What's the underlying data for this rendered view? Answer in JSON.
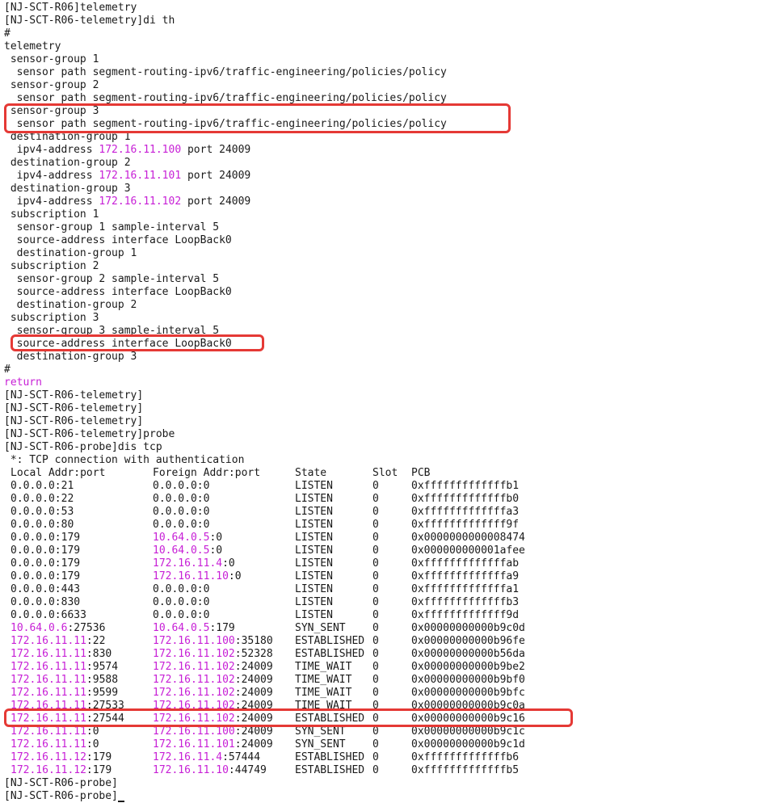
{
  "config_lines": [
    "[NJ-SCT-R06]telemetry",
    "[NJ-SCT-R06-telemetry]di th",
    "#",
    "telemetry",
    " sensor-group 1",
    "  sensor path segment-routing-ipv6/traffic-engineering/policies/policy",
    " sensor-group 2",
    "  sensor path segment-routing-ipv6/traffic-engineering/policies/policy",
    " sensor-group 3",
    "  sensor path segment-routing-ipv6/traffic-engineering/policies/policy",
    " destination-group 1",
    [
      "  ipv4-address ",
      "172.16.11.100",
      " port 24009"
    ],
    " destination-group 2",
    [
      "  ipv4-address ",
      "172.16.11.101",
      " port 24009"
    ],
    " destination-group 3",
    [
      "  ipv4-address ",
      "172.16.11.102",
      " port 24009"
    ],
    " subscription 1",
    "  sensor-group 1 sample-interval 5",
    "  source-address interface LoopBack0",
    "  destination-group 1",
    " subscription 2",
    "  sensor-group 2 sample-interval 5",
    "  source-address interface LoopBack0",
    "  destination-group 2",
    " subscription 3",
    "  sensor-group 3 sample-interval 5",
    "  source-address interface LoopBack0",
    "  destination-group 3",
    "#"
  ],
  "return_word": "return",
  "post_lines": [
    "[NJ-SCT-R06-telemetry]",
    "[NJ-SCT-R06-telemetry]",
    "[NJ-SCT-R06-telemetry]",
    "[NJ-SCT-R06-telemetry]probe",
    "[NJ-SCT-R06-probe]dis tcp",
    " *: TCP connection with authentication"
  ],
  "tcp_header": [
    "Local Addr:port",
    "Foreign Addr:port",
    "State",
    "Slot",
    "PCB"
  ],
  "tcp_rows": [
    [
      [
        "",
        "0.0.0.0",
        ":21"
      ],
      [
        "",
        "0.0.0.0",
        ":0"
      ],
      "LISTEN",
      "0",
      "0xfffffffffffffb1"
    ],
    [
      [
        "",
        "0.0.0.0",
        ":22"
      ],
      [
        "",
        "0.0.0.0",
        ":0"
      ],
      "LISTEN",
      "0",
      "0xfffffffffffffb0"
    ],
    [
      [
        "",
        "0.0.0.0",
        ":53"
      ],
      [
        "",
        "0.0.0.0",
        ":0"
      ],
      "LISTEN",
      "0",
      "0xfffffffffffffa3"
    ],
    [
      [
        "",
        "0.0.0.0",
        ":80"
      ],
      [
        "",
        "0.0.0.0",
        ":0"
      ],
      "LISTEN",
      "0",
      "0xfffffffffffff9f"
    ],
    [
      [
        "",
        "0.0.0.0",
        ":179"
      ],
      [
        "ip",
        "10.64.0.5",
        ":0"
      ],
      "LISTEN",
      "0",
      "0x0000000000008474"
    ],
    [
      [
        "",
        "0.0.0.0",
        ":179"
      ],
      [
        "ip",
        "10.64.0.5",
        ":0"
      ],
      "LISTEN",
      "0",
      "0x000000000001afee"
    ],
    [
      [
        "",
        "0.0.0.0",
        ":179"
      ],
      [
        "ip",
        "172.16.11.4",
        ":0"
      ],
      "LISTEN",
      "0",
      "0xfffffffffffffab"
    ],
    [
      [
        "",
        "0.0.0.0",
        ":179"
      ],
      [
        "ip",
        "172.16.11.10",
        ":0"
      ],
      "LISTEN",
      "0",
      "0xfffffffffffffa9"
    ],
    [
      [
        "",
        "0.0.0.0",
        ":443"
      ],
      [
        "",
        "0.0.0.0",
        ":0"
      ],
      "LISTEN",
      "0",
      "0xfffffffffffffa1"
    ],
    [
      [
        "",
        "0.0.0.0",
        ":830"
      ],
      [
        "",
        "0.0.0.0",
        ":0"
      ],
      "LISTEN",
      "0",
      "0xfffffffffffffb3"
    ],
    [
      [
        "",
        "0.0.0.0",
        ":6633"
      ],
      [
        "",
        "0.0.0.0",
        ":0"
      ],
      "LISTEN",
      "0",
      "0xfffffffffffff9d"
    ],
    [
      [
        "ip",
        "10.64.0.6",
        ":27536"
      ],
      [
        "ip",
        "10.64.0.5",
        ":179"
      ],
      "SYN_SENT",
      "0",
      "0x00000000000b9c0d"
    ],
    [
      [
        "ip",
        "172.16.11.11",
        ":22"
      ],
      [
        "ip",
        "172.16.11.100",
        ":35180"
      ],
      "ESTABLISHED",
      "0",
      "0x00000000000b96fe"
    ],
    [
      [
        "ip",
        "172.16.11.11",
        ":830"
      ],
      [
        "ip",
        "172.16.11.102",
        ":52328"
      ],
      "ESTABLISHED",
      "0",
      "0x00000000000b56da"
    ],
    [
      [
        "ip",
        "172.16.11.11",
        ":9574"
      ],
      [
        "ip",
        "172.16.11.102",
        ":24009"
      ],
      "TIME_WAIT",
      "0",
      "0x00000000000b9be2"
    ],
    [
      [
        "ip",
        "172.16.11.11",
        ":9588"
      ],
      [
        "ip",
        "172.16.11.102",
        ":24009"
      ],
      "TIME_WAIT",
      "0",
      "0x00000000000b9bf0"
    ],
    [
      [
        "ip",
        "172.16.11.11",
        ":9599"
      ],
      [
        "ip",
        "172.16.11.102",
        ":24009"
      ],
      "TIME_WAIT",
      "0",
      "0x00000000000b9bfc"
    ],
    [
      [
        "ip",
        "172.16.11.11",
        ":27533"
      ],
      [
        "ip",
        "172.16.11.102",
        ":24009"
      ],
      "TIME_WAIT",
      "0",
      "0x00000000000b9c0a"
    ],
    [
      [
        "ip",
        "172.16.11.11",
        ":27544"
      ],
      [
        "ip",
        "172.16.11.102",
        ":24009"
      ],
      "ESTABLISHED",
      "0",
      "0x00000000000b9c16"
    ],
    [
      [
        "ip",
        "172.16.11.11",
        ":0"
      ],
      [
        "ip",
        "172.16.11.100",
        ":24009"
      ],
      "SYN_SENT",
      "0",
      "0x00000000000b9c1c"
    ],
    [
      [
        "ip",
        "172.16.11.11",
        ":0"
      ],
      [
        "ip",
        "172.16.11.101",
        ":24009"
      ],
      "SYN_SENT",
      "0",
      "0x00000000000b9c1d"
    ],
    [
      [
        "ip",
        "172.16.11.12",
        ":179"
      ],
      [
        "ip",
        "172.16.11.4",
        ":57444"
      ],
      "ESTABLISHED",
      "0",
      "0xfffffffffffffb6"
    ],
    [
      [
        "ip",
        "172.16.11.12",
        ":179"
      ],
      [
        "ip",
        "172.16.11.10",
        ":44749"
      ],
      "ESTABLISHED",
      "0",
      "0xfffffffffffffb5"
    ]
  ],
  "tail_lines": [
    "[NJ-SCT-R06-probe]",
    "[NJ-SCT-R06-probe]"
  ],
  "colors": {
    "ip_magenta": "#c71fd6",
    "highlight_red": "#e53935",
    "text": "#1a1a1a",
    "background": "#ffffff"
  }
}
